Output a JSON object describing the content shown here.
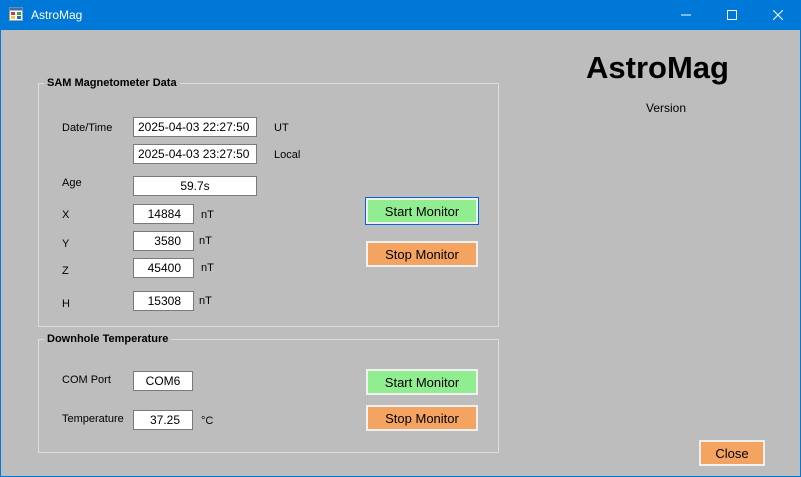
{
  "window": {
    "title": "AstroMag",
    "icons": {
      "app": "app-window-icon",
      "minimize": "minimize-icon",
      "maximize": "maximize-icon",
      "close": "close-icon"
    }
  },
  "brand": {
    "title": "AstroMag",
    "version_label": "Version"
  },
  "sam": {
    "legend": "SAM Magnetometer Data",
    "datetime_label": "Date/Time",
    "ut_value": "2025-04-03 22:27:50",
    "ut_label": "UT",
    "local_value": "2025-04-03 23:27:50",
    "local_label": "Local",
    "age_label": "Age",
    "age_value": "59.7s",
    "x_label": "X",
    "x_value": "14884",
    "x_unit": "nT",
    "y_label": "Y",
    "y_value": "3580",
    "y_unit": "nT",
    "z_label": "Z",
    "z_value": "45400",
    "z_unit": "nT",
    "h_label": "H",
    "h_value": "15308",
    "h_unit": "nT",
    "start_label": "Start Monitor",
    "stop_label": "Stop Monitor"
  },
  "downhole": {
    "legend": "Downhole Temperature",
    "com_label": "COM Port",
    "com_value": "COM6",
    "temp_label": "Temperature",
    "temp_value": "37.25",
    "temp_unit": "°C",
    "start_label": "Start Monitor",
    "stop_label": "Stop Monitor"
  },
  "close_label": "Close",
  "colors": {
    "title_bar": "#0078d7",
    "client_bg": "#bdbdbd",
    "start_button": "#90ee90",
    "stop_button": "#f4a460"
  }
}
